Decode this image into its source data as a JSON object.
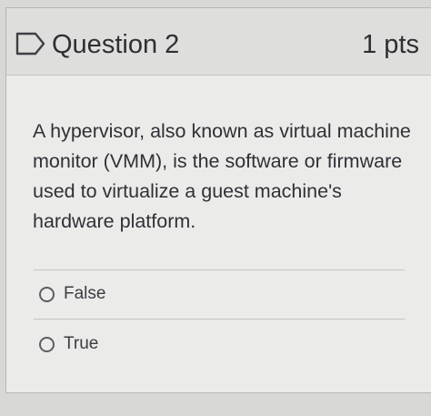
{
  "question": {
    "title": "Question 2",
    "points": "1 pts",
    "text": "A hypervisor, also known as virtual machine monitor (VMM), is the software or firmware used to virtualize a guest machine's hardware platform.",
    "flag_icon": "flag-icon"
  },
  "answers": [
    {
      "label": "False",
      "selected": false
    },
    {
      "label": "True",
      "selected": false
    }
  ]
}
